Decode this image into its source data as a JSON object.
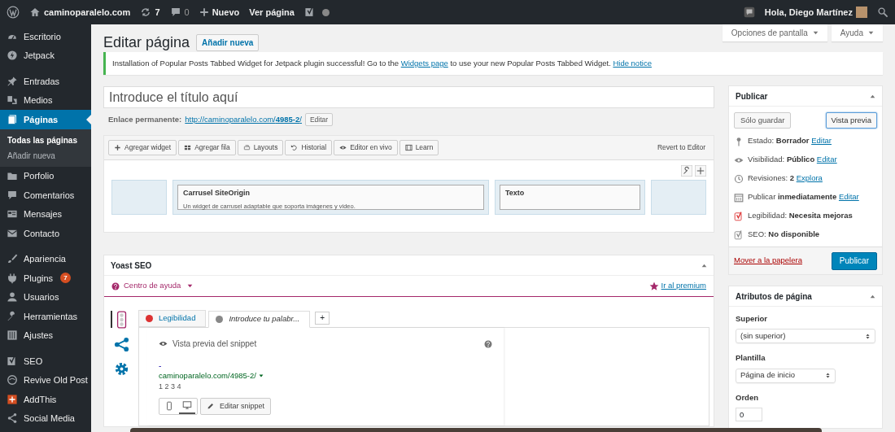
{
  "admin_bar": {
    "site": "caminoparalelo.com",
    "updates": "7",
    "comments": "0",
    "new": "Nuevo",
    "view": "Ver página",
    "greeting": "Hola, Diego Martínez"
  },
  "sidebar": {
    "groups": [
      [
        {
          "label": "Escritorio",
          "selected": false
        },
        {
          "label": "Jetpack",
          "selected": false
        }
      ],
      [
        {
          "label": "Entradas",
          "selected": false
        },
        {
          "label": "Medios",
          "selected": false
        },
        {
          "label": "Páginas",
          "selected": true,
          "children": [
            {
              "label": "Todas las páginas",
              "selected": true
            },
            {
              "label": "Añadir nueva",
              "selected": false
            }
          ]
        },
        {
          "label": "Porfolio",
          "selected": false
        },
        {
          "label": "Comentarios",
          "selected": false
        },
        {
          "label": "Mensajes",
          "selected": false
        },
        {
          "label": "Contacto",
          "selected": false
        }
      ],
      [
        {
          "label": "Apariencia",
          "selected": false
        },
        {
          "label": "Plugins",
          "selected": false,
          "badge": "7"
        },
        {
          "label": "Usuarios",
          "selected": false
        },
        {
          "label": "Herramientas",
          "selected": false
        },
        {
          "label": "Ajustes",
          "selected": false
        }
      ],
      [
        {
          "label": "SEO",
          "selected": false
        },
        {
          "label": "Revive Old Post",
          "selected": false
        },
        {
          "label": "AddThis",
          "selected": false
        },
        {
          "label": "Social Media",
          "selected": false
        }
      ]
    ]
  },
  "header": {
    "title": "Editar página",
    "add_new": "Añadir nueva",
    "screen_options": "Opciones de pantalla",
    "help": "Ayuda"
  },
  "notice": {
    "text_before": "Installation of Popular Posts Tabbed Widget for Jetpack plugin successful! Go to the",
    "link": "Widgets page",
    "text_after": "to use your new Popular Posts Tabbed Widget.",
    "dismiss": "Hide notice"
  },
  "title_field": {
    "placeholder": "Introduce el título aquí"
  },
  "permalink": {
    "label": "Enlace permanente:",
    "url": "http://caminoparalelo.com/**4985-2**/",
    "button": "Editar"
  },
  "builder": {
    "toolbar": [
      "Agregar widget",
      "Agregar fila",
      "Layouts",
      "Historial",
      "Editor en vivo",
      "Learn"
    ],
    "revert": "Revert to Editor",
    "cells": [
      {
        "kind": "empty"
      },
      {
        "kind": "widget",
        "title": "Carrusel SiteOrigin",
        "description": "Un widget de carrusel adaptable que soporta imágenes y video."
      },
      {
        "kind": "widget",
        "title": "Texto"
      },
      {
        "kind": "empty"
      }
    ]
  },
  "yoast": {
    "title": "Yoast SEO",
    "help": "Centro de ayuda",
    "premium": "Ir al premium",
    "side_tabs": [
      {
        "kind": "analysis",
        "selected": true
      },
      {
        "kind": "social",
        "selected": false
      },
      {
        "kind": "settings",
        "selected": false
      }
    ],
    "tabs": [
      {
        "label": "Legibilidad",
        "selected": false,
        "color": "#dc3232"
      },
      {
        "label": "Introduce tu palabr...",
        "selected": true,
        "color": "#888888"
      }
    ],
    "add_tab": "+",
    "snippet": {
      "heading": "Vista previa del snippet",
      "title": "-",
      "url": "caminoparalelo.com/4985-2/",
      "description": "1 2 3 4",
      "devices": [
        {
          "kind": "mobile",
          "selected": false
        },
        {
          "kind": "desktop",
          "selected": true
        }
      ],
      "edit": "Editar snippet"
    }
  },
  "publish": {
    "title": "Publicar",
    "save": "Sólo guardar",
    "preview": "Vista previa",
    "items": [
      {
        "kind": "status",
        "label": "Estado:",
        "value": "Borrador",
        "link": "Editar"
      },
      {
        "kind": "visibility",
        "label": "Visibilidad:",
        "value": "Público",
        "link": "Editar"
      },
      {
        "kind": "revisions",
        "label": "Revisiones:",
        "value": "2",
        "link": "Explora"
      },
      {
        "kind": "schedule",
        "label": "Publicar",
        "value": "inmediatamente",
        "link": "Editar"
      },
      {
        "kind": "readability",
        "label": "Legibilidad:",
        "value": "Necesita mejoras"
      },
      {
        "kind": "seo",
        "label": "SEO:",
        "value": "No disponible"
      }
    ],
    "trash": "Mover a la papelera",
    "submit": "Publicar"
  },
  "attributes": {
    "title": "Atributos de página",
    "parent_label": "Superior",
    "parent_value": "(sin superior)",
    "template_label": "Plantilla",
    "template_value": "Página de inicio",
    "order_label": "Orden",
    "order_value": "0"
  }
}
